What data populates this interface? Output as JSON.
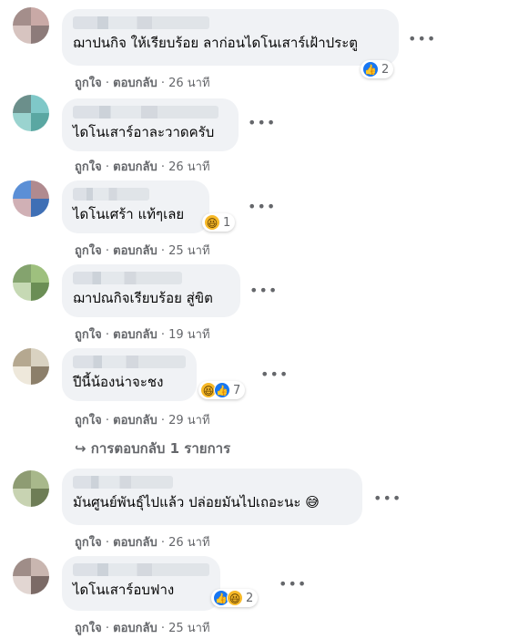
{
  "comments": [
    {
      "text": "ฌาปนกิจ ให้เรียบร้อย ลาก่อนไดโนเสาร์เฝ้าประตู",
      "reactions": {
        "icons": [
          "like-icon"
        ],
        "count": "2"
      },
      "meta": {
        "like": "ถูกใจ",
        "sep": " · ",
        "reply": "ตอบกลับ",
        "time": "26 นาที"
      }
    },
    {
      "text": "ไดโนเสาร์อาละวาดครับ",
      "meta": {
        "like": "ถูกใจ",
        "sep": " · ",
        "reply": "ตอบกลับ",
        "time": "26 นาที"
      }
    },
    {
      "text": "ไดโนเศร้า แท้ๆเลย",
      "reactions": {
        "icons": [
          "haha-icon"
        ],
        "count": "1"
      },
      "meta": {
        "like": "ถูกใจ",
        "sep": " · ",
        "reply": "ตอบกลับ",
        "time": "25 นาที"
      }
    },
    {
      "text": "ฌาปณกิจเรียบร้อย สู่ขิต",
      "meta": {
        "like": "ถูกใจ",
        "sep": " · ",
        "reply": "ตอบกลับ",
        "time": "19 นาที"
      }
    },
    {
      "text": "ปีนี้น้องน่าจะชง",
      "reactions": {
        "icons": [
          "haha-icon",
          "like-icon"
        ],
        "count": "7"
      },
      "meta": {
        "like": "ถูกใจ",
        "sep": " · ",
        "reply": "ตอบกลับ",
        "time": "29 นาที"
      },
      "replies": "↪ การตอบกลับ 1 รายการ"
    },
    {
      "text": "มันศูนย์พันธุ์ไปแล้ว ปล่อยมันไปเถอะนะ 😅",
      "meta": {
        "like": "ถูกใจ",
        "sep": " · ",
        "reply": "ตอบกลับ",
        "time": "26 นาที"
      }
    },
    {
      "text": "ไดโนเสาร์อบฟาง",
      "reactions": {
        "icons": [
          "like-icon",
          "haha-icon"
        ],
        "count": "2"
      },
      "meta": {
        "like": "ถูกใจ",
        "sep": " · ",
        "reply": "ตอบกลับ",
        "time": "25 นาที"
      }
    }
  ],
  "more_label": "•••",
  "colors": {
    "bubble": "#f0f2f5",
    "meta": "#65676b",
    "like": "#1877f2",
    "haha": "#f7b928"
  }
}
